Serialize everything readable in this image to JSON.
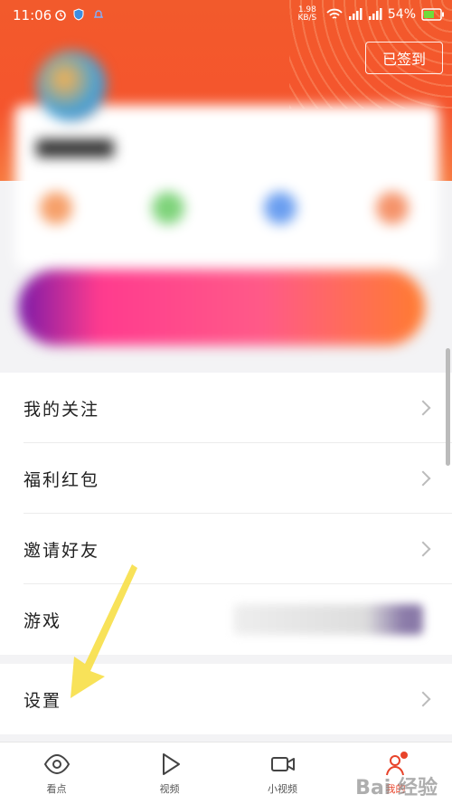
{
  "status_bar": {
    "time": "11:06",
    "speed": "1.98 KB/S",
    "battery": "54%"
  },
  "header": {
    "sign_in_label": "已签到"
  },
  "menu": {
    "items": [
      {
        "label": "我的关注"
      },
      {
        "label": "福利红包"
      },
      {
        "label": "邀请好友"
      },
      {
        "label": "游戏"
      }
    ],
    "settings_label": "设置"
  },
  "tabs": [
    {
      "label": "看点",
      "icon": "eye-icon"
    },
    {
      "label": "视频",
      "icon": "play-icon"
    },
    {
      "label": "小视频",
      "icon": "video-camera-icon"
    },
    {
      "label": "我的",
      "icon": "profile-icon",
      "active": true
    }
  ],
  "watermark": "Bai 经验",
  "colors": {
    "accent": "#e8432a",
    "header": "#f25a2c",
    "annotation_arrow": "#f7e04b"
  }
}
